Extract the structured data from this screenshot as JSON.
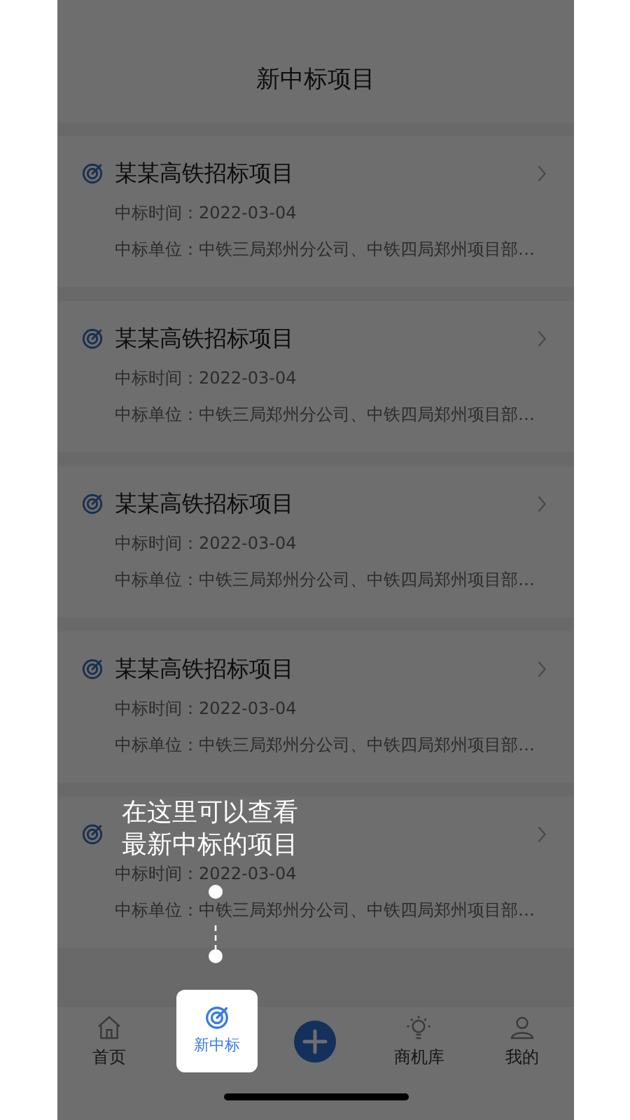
{
  "header": {
    "title": "新中标项目"
  },
  "items": [
    {
      "title": "某某高铁招标项目",
      "time": "中标时间：2022-03-04",
      "unit": "中标单位：中铁三局郑州分公司、中铁四局郑州项目部…"
    },
    {
      "title": "某某高铁招标项目",
      "time": "中标时间：2022-03-04",
      "unit": "中标单位：中铁三局郑州分公司、中铁四局郑州项目部…"
    },
    {
      "title": "某某高铁招标项目",
      "time": "中标时间：2022-03-04",
      "unit": "中标单位：中铁三局郑州分公司、中铁四局郑州项目部…"
    },
    {
      "title": "某某高铁招标项目",
      "time": "中标时间：2022-03-04",
      "unit": "中标单位：中铁三局郑州分公司、中铁四局郑州项目部…"
    },
    {
      "time": "中标时间：2022-03-04",
      "unit": "中标单位：中铁三局郑州分公司、中铁四局郑州项目部…"
    }
  ],
  "guide": {
    "lines": [
      "在这里可以查看",
      "最新中标的项目"
    ]
  },
  "tabs": [
    {
      "kind": "home",
      "label": "首页",
      "selected": false
    },
    {
      "kind": "target",
      "label": "新中标",
      "selected": true
    },
    {
      "kind": "add"
    },
    {
      "kind": "bulb",
      "label": "商机库",
      "selected": false
    },
    {
      "kind": "person",
      "label": "我的",
      "selected": false
    }
  ]
}
